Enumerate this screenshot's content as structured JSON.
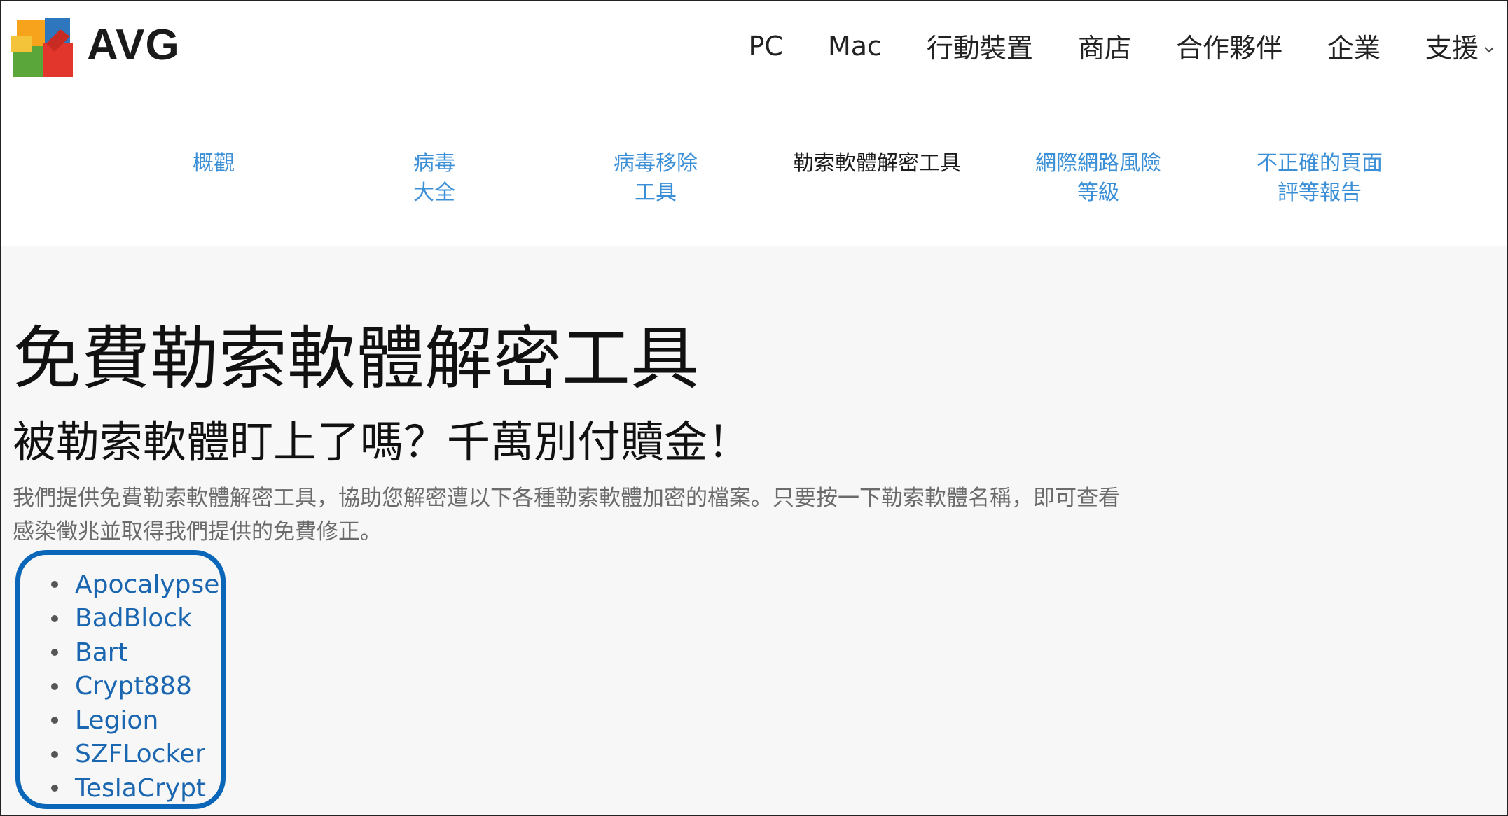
{
  "brand": {
    "name": "AVG",
    "colors": [
      "#e2352b",
      "#f7a31c",
      "#5aa63b",
      "#2e76bd"
    ]
  },
  "main_nav": {
    "items": [
      {
        "label": "PC"
      },
      {
        "label": "Mac"
      },
      {
        "label": "行動裝置"
      },
      {
        "label": "商店"
      },
      {
        "label": "合作夥伴"
      },
      {
        "label": "企業"
      },
      {
        "label": "支援",
        "icon": "chevron-down-icon"
      }
    ]
  },
  "sub_nav": {
    "items": [
      {
        "label": "概觀",
        "active": false
      },
      {
        "label": "病毒\n大全",
        "active": false
      },
      {
        "label": "病毒移除\n工具",
        "active": false
      },
      {
        "label": "勒索軟體解密工具",
        "active": true
      },
      {
        "label": "網際網路風險\n等級",
        "active": false
      },
      {
        "label": "不正確的頁面\n評等報告",
        "active": false
      }
    ]
  },
  "content": {
    "title": "免費勒索軟體解密工具",
    "subtitle": "被勒索軟體盯上了嗎？千萬別付贖金！",
    "intro": "我們提供免費勒索軟體解密工具，協助您解密遭以下各種勒索軟體加密的檔案。只要按一下勒索軟體名稱，即可查看感染徵兆並取得我們提供的免費修正。",
    "ransomware": [
      "Apocalypse",
      "BadBlock",
      "Bart",
      "Crypt888",
      "Legion",
      "SZFLocker",
      "TeslaCrypt"
    ]
  },
  "theme": {
    "link_color": "#3b8fd6",
    "list_link_color": "#1a66b0",
    "highlight_border": "#0a66b8"
  }
}
